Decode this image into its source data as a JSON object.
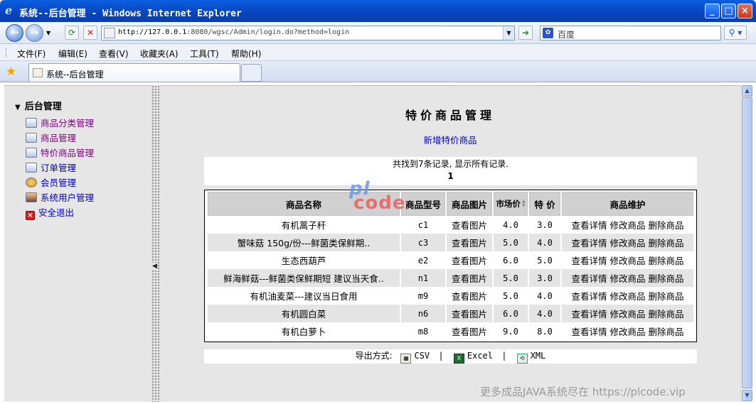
{
  "window": {
    "title": "系统--后台管理 - Windows Internet Explorer",
    "minimize": "_",
    "maximize": "□",
    "close": "×"
  },
  "navbar": {
    "back_icon": "back-arrow-icon",
    "forward_icon": "forward-arrow-icon",
    "address_host": "http://127.0.0.1",
    "address_rest": ":8080/wgsc/Admin/login.do?method=login",
    "go_icon": "go-arrow-icon",
    "search_engine": "百度"
  },
  "menu": [
    "文件(F)",
    "编辑(E)",
    "查看(V)",
    "收藏夹(A)",
    "工具(T)",
    "帮助(H)"
  ],
  "tab": {
    "title": "系统--后台管理"
  },
  "sidebar": {
    "heading": "后台管理",
    "items": [
      {
        "label": "商品分类管理",
        "icon": "category-icon",
        "visited": true
      },
      {
        "label": "商品管理",
        "icon": "image-icon",
        "visited": true
      },
      {
        "label": "特价商品管理",
        "icon": "image-icon",
        "visited": true
      },
      {
        "label": "订单管理",
        "icon": "image-icon",
        "visited": false
      },
      {
        "label": "会员管理",
        "icon": "users-icon",
        "visited": false
      },
      {
        "label": "系统用户管理",
        "icon": "user-icon",
        "visited": false
      },
      {
        "label": "安全退出",
        "icon": "exit-x-icon",
        "visited": false
      }
    ]
  },
  "main": {
    "title": "特价商品管理",
    "new_link": "新增特价商品",
    "summary": "共找到7条记录, 显示所有记录.",
    "page": "1",
    "columns": [
      "商品名称",
      "商品型号",
      "商品图片",
      "市场价",
      "特 价",
      "商品维护"
    ],
    "actions": {
      "view_image": "查看图片",
      "detail": "查看详情",
      "edit": "修改商品",
      "delete": "删除商品"
    },
    "rows": [
      {
        "name": "有机蒿子秆",
        "model": "c1",
        "market": "4.0",
        "special": "3.0"
      },
      {
        "name": "蟹味菇 150g/份---鲜菌类保鲜期..",
        "model": "c3",
        "market": "5.0",
        "special": "4.0"
      },
      {
        "name": "生态西葫芦",
        "model": "e2",
        "market": "6.0",
        "special": "5.0"
      },
      {
        "name": "鲜海鲜菇---鲜菌类保鲜期短 建议当天食..",
        "model": "n1",
        "market": "5.0",
        "special": "3.0"
      },
      {
        "name": "有机油麦菜---建议当日食用",
        "model": "m9",
        "market": "5.0",
        "special": "4.0"
      },
      {
        "name": "有机圆白菜",
        "model": "n6",
        "market": "6.0",
        "special": "4.0"
      },
      {
        "name": "有机白萝卜",
        "model": "m8",
        "market": "9.0",
        "special": "8.0"
      }
    ],
    "export": {
      "label": "导出方式:",
      "csv": "CSV",
      "excel": "Excel",
      "xml": "XML"
    }
  },
  "watermark": {
    "line1": "pl",
    "line2": "code"
  },
  "footer_watermark": "更多成品JAVA系统尽在 https://plcode.vip"
}
